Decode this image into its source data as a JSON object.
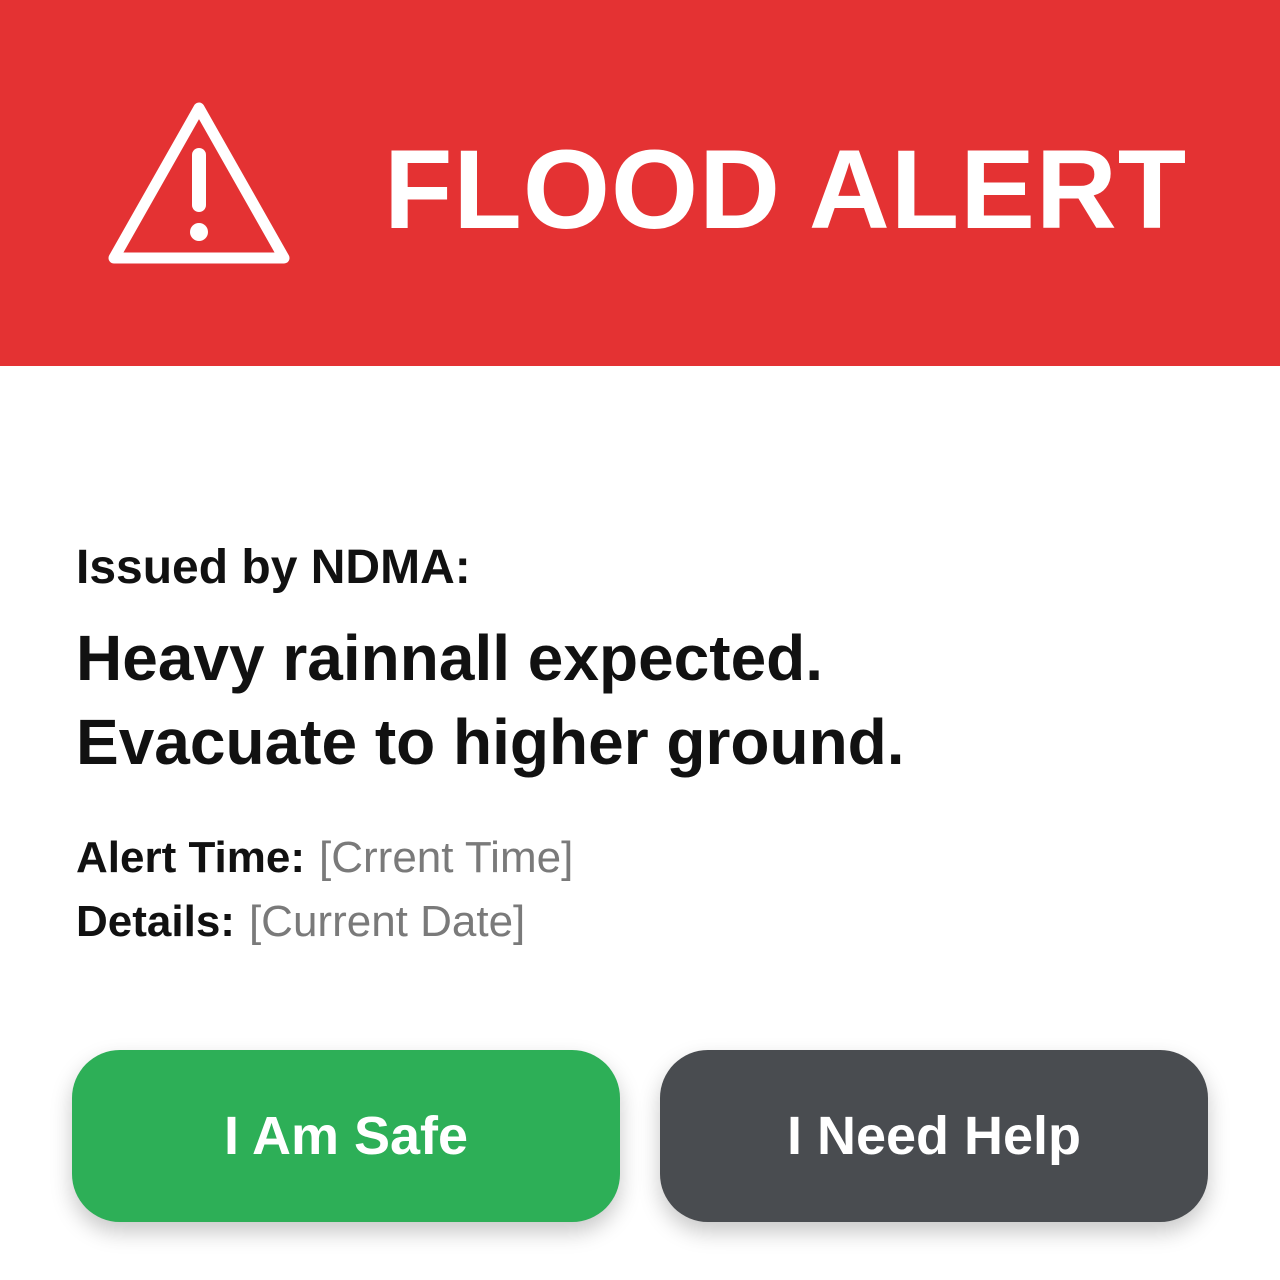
{
  "header": {
    "title": "FLOOD ALERT",
    "icon": "warning-triangle-icon",
    "background_color": "#e43233"
  },
  "alert": {
    "issuer": "Issued by NDMA:",
    "message_lines": [
      "Heavy rainnall expected.",
      "Evacuate to higher ground."
    ],
    "time_label": "Alert Time:",
    "time_value": "[Crrent Time]",
    "details_label": "Details:",
    "details_value": "[Current Date]"
  },
  "actions": {
    "safe_label": "I Am Safe",
    "safe_color": "#2daf57",
    "help_label": "I Need Help",
    "help_color": "#494c50"
  }
}
